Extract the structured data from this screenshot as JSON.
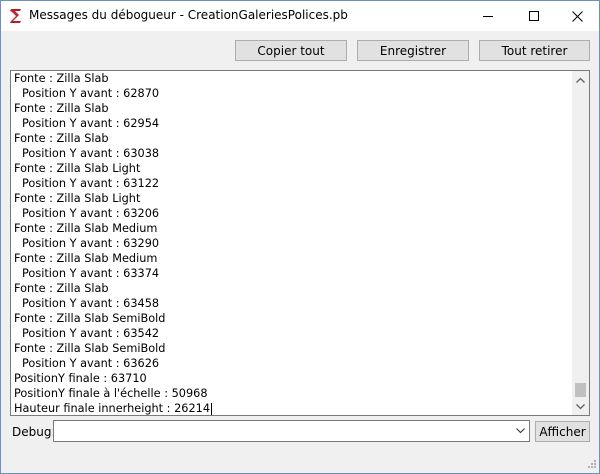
{
  "window": {
    "title": "Messages du débogueur - CreationGaleriesPolices.pb",
    "accent_color": "#c1272d"
  },
  "toolbar": {
    "copy_label": "Copier tout",
    "save_label": "Enregistrer",
    "clear_label": "Tout retirer"
  },
  "log": {
    "lines": [
      "Fonte : Zilla Slab",
      "Position Y avant : 62870",
      "Fonte : Zilla Slab",
      "Position Y avant : 62954",
      "Fonte : Zilla Slab",
      "Position Y avant : 63038",
      "Fonte : Zilla Slab Light",
      "Position Y avant : 63122",
      "Fonte : Zilla Slab Light",
      "Position Y avant : 63206",
      "Fonte : Zilla Slab Medium",
      "Position Y avant : 63290",
      "Fonte : Zilla Slab Medium",
      "Position Y avant : 63374",
      "Fonte : Zilla Slab",
      "Position Y avant : 63458",
      "Fonte : Zilla Slab SemiBold",
      "Position Y avant : 63542",
      "Fonte : Zilla Slab SemiBold",
      "Position Y avant : 63626",
      "PositionY finale : 63710",
      "PositionY finale à l'échelle : 50968",
      "Hauteur finale innerheight : 26214"
    ]
  },
  "debug": {
    "label": "Debug:",
    "input_value": "",
    "show_label": "Afficher"
  }
}
